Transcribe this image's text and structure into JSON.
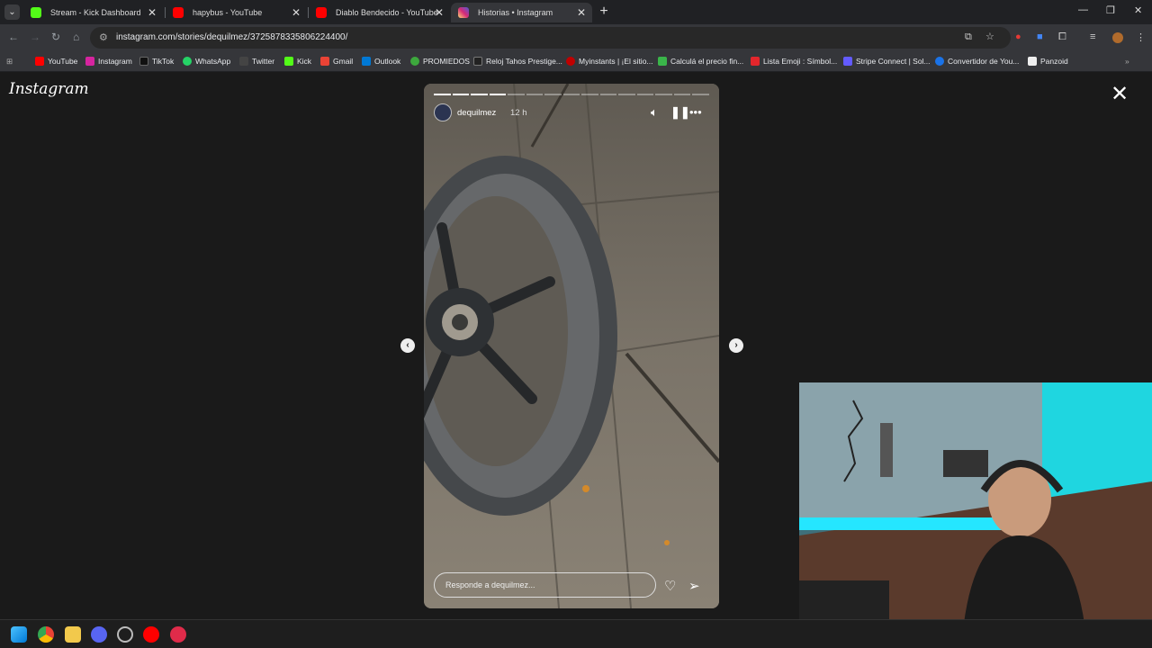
{
  "browser": {
    "tabs": [
      {
        "title": "Stream - Kick Dashboard",
        "active": false,
        "color": "#53fc18"
      },
      {
        "title": "hapybus - YouTube",
        "active": false,
        "color": "#ff0000"
      },
      {
        "title": "Diablo Bendecido - YouTube",
        "active": false,
        "color": "#ff0000"
      },
      {
        "title": "Historias • Instagram",
        "active": true,
        "color": "#d6249f"
      }
    ],
    "new_tab": "+",
    "url": "instagram.com/stories/dequilmez/3725878335806224400/",
    "bookmarks": [
      {
        "label": "YouTube",
        "color": "#ff0000"
      },
      {
        "label": "Instagram",
        "color": "#d6249f"
      },
      {
        "label": "TikTok",
        "color": "#111111"
      },
      {
        "label": "WhatsApp",
        "color": "#25d366"
      },
      {
        "label": "Twitter",
        "color": "#444444"
      },
      {
        "label": "Kick",
        "color": "#53fc18"
      },
      {
        "label": "Gmail",
        "color": "#ea4335"
      },
      {
        "label": "Outlook",
        "color": "#0078d4"
      },
      {
        "label": "PROMIEDOS",
        "color": "#3da83d"
      },
      {
        "label": "Reloj Tahos Prestige...",
        "color": "#222222"
      },
      {
        "label": "Myinstants | ¡El sitio...",
        "color": "#c00000"
      },
      {
        "label": "Calculá el precio fin...",
        "color": "#3ab54a"
      },
      {
        "label": "Lista Emoji : Símbol...",
        "color": "#e3262c"
      },
      {
        "label": "Stripe Connect | Sol...",
        "color": "#635bff"
      },
      {
        "label": "Convertidor de You...",
        "color": "#1a73e8"
      },
      {
        "label": "Panzoid",
        "color": "#eeeeee"
      }
    ]
  },
  "instagram": {
    "logo": "Instagram",
    "story": {
      "username": "dequilmez",
      "time": "12 h",
      "reply_placeholder": "Responde a dequilmez...",
      "segments_total": 15,
      "segments_done": 4
    }
  },
  "icons": {
    "close": "close-icon",
    "prev": "chevron-left-icon",
    "next": "chevron-right-icon",
    "mute": "volume-icon",
    "pause": "pause-icon",
    "more": "more-icon",
    "heart": "heart-icon",
    "share": "send-icon"
  }
}
